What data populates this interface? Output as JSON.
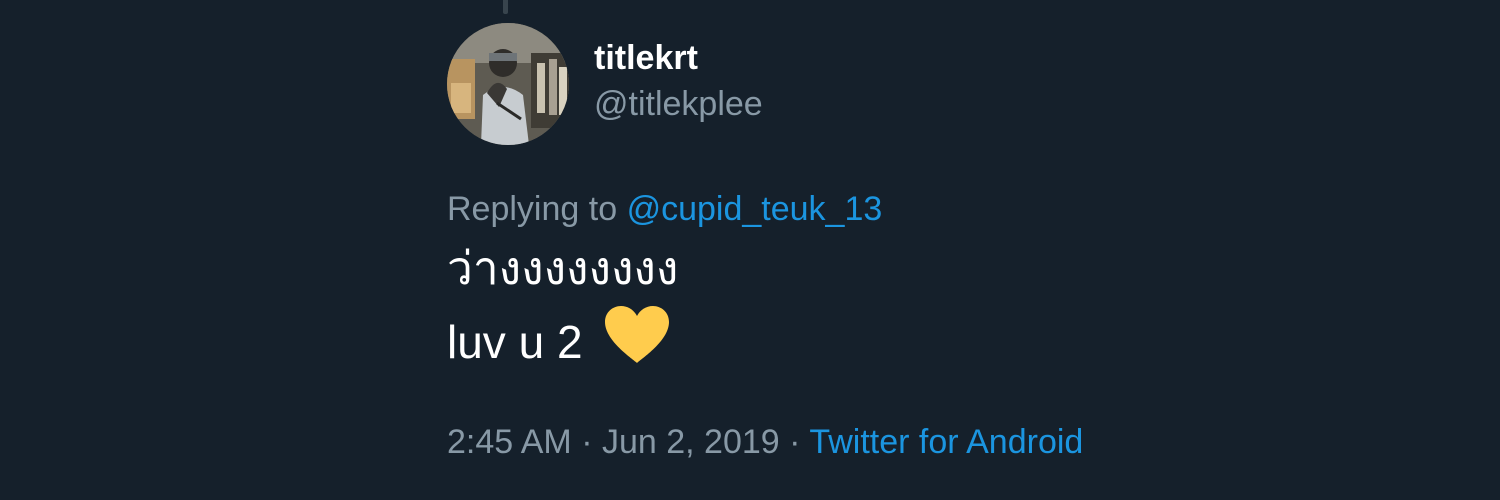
{
  "tweet": {
    "author": {
      "display_name": "titlekrt",
      "handle": "@titlekplee"
    },
    "replying_to_label": "Replying to",
    "replying_to_handle": "@cupid_teuk_13",
    "text_line1": "ว่างงงงงงงง",
    "text_line2": "luv u 2",
    "emoji": "yellow-heart-icon",
    "time": "2:45 AM",
    "separator": "·",
    "date": "Jun 2, 2019",
    "source": "Twitter for Android"
  },
  "colors": {
    "background": "#15202b",
    "text_primary": "#ffffff",
    "text_secondary": "#8899a6",
    "link": "#1b95e0",
    "heart": "#ffcc4d"
  }
}
